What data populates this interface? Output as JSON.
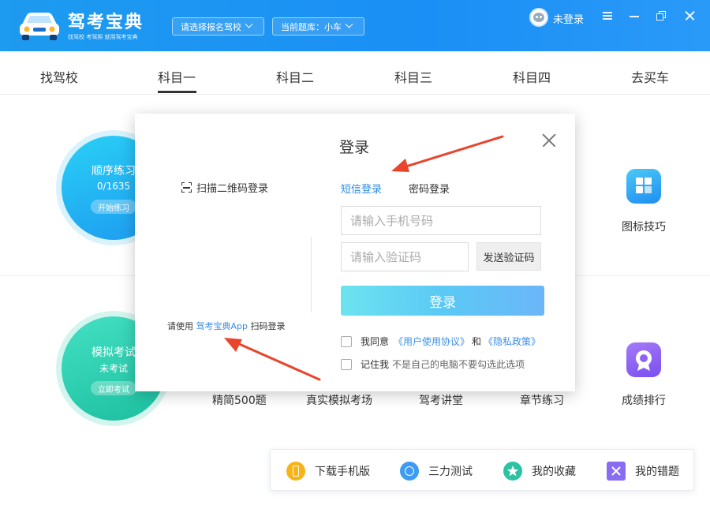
{
  "app": {
    "title": "驾考宝典",
    "subtitle": "找驾校 考驾照 就用驾考宝典",
    "school_select": "请选择报名驾校",
    "bank_select": "当前题库：小车",
    "login_state": "未登录"
  },
  "nav": {
    "tabs": [
      "找驾校",
      "科目一",
      "科目二",
      "科目三",
      "科目四",
      "去买车"
    ],
    "active": "科目一"
  },
  "practice": {
    "sequence": {
      "title": "顺序练习",
      "progress": "0/1635",
      "button": "开始练习"
    },
    "mock": {
      "title": "模拟考试",
      "status": "未考试",
      "button": "立即考试"
    }
  },
  "features": {
    "icon_tips": "图标技巧",
    "ranking": "成绩排行",
    "row2": [
      "精简500题",
      "真实模拟考场",
      "驾考讲堂",
      "章节练习"
    ]
  },
  "toolbar": {
    "items": [
      {
        "label": "下载手机版",
        "icon": "phone-icon",
        "color": "#f6b418"
      },
      {
        "label": "三力测试",
        "icon": "brain-icon",
        "color": "#3d9bf3"
      },
      {
        "label": "我的收藏",
        "icon": "star-icon",
        "color": "#2cc3a4"
      },
      {
        "label": "我的错题",
        "icon": "x-icon",
        "color": "#8a6cf2"
      }
    ]
  },
  "login_modal": {
    "title": "登录",
    "qr_tab": "扫描二维码登录",
    "qr_hint_prefix": "请使用",
    "qr_hint_app": "驾考宝典App",
    "qr_hint_suffix": "扫码登录",
    "tab_sms": "短信登录",
    "tab_password": "密码登录",
    "phone_placeholder": "请输入手机号码",
    "code_placeholder": "请输入验证码",
    "send_code": "发送验证码",
    "submit": "登录",
    "agree_prefix": "我同意",
    "user_agreement": "《用户使用协议》",
    "and": "和",
    "privacy_policy": "《隐私政策》",
    "remember_me": "记住我",
    "remember_hint": "不是自己的电脑不要勾选此选项"
  },
  "colors": {
    "header": "#1d9bf0",
    "link": "#3a8fe6",
    "annotation_arrow": "#e8452c"
  }
}
